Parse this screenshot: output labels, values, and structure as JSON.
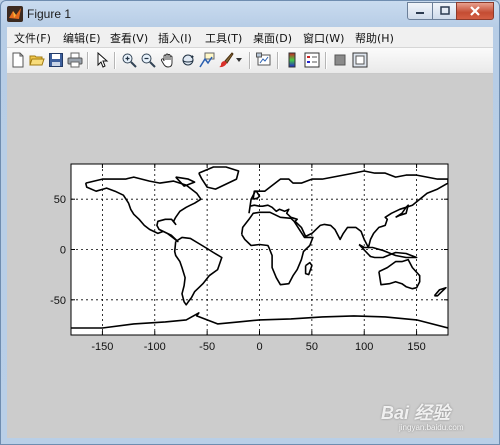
{
  "window": {
    "title": "Figure 1",
    "controls": {
      "minimize": "minimize-icon",
      "maximize": "maximize-icon",
      "close": "close-icon"
    }
  },
  "menubar": {
    "items": [
      {
        "label": "文件(F)"
      },
      {
        "label": "编辑(E)"
      },
      {
        "label": "查看(V)"
      },
      {
        "label": "插入(I)"
      },
      {
        "label": "工具(T)"
      },
      {
        "label": "桌面(D)"
      },
      {
        "label": "窗口(W)"
      },
      {
        "label": "帮助(H)"
      }
    ]
  },
  "toolbar": {
    "buttons": [
      {
        "icon": "new-figure-icon"
      },
      {
        "icon": "open-file-icon"
      },
      {
        "icon": "save-icon"
      },
      {
        "icon": "print-icon"
      },
      {
        "icon": "edit-plot-arrow-icon"
      },
      {
        "icon": "zoom-in-icon"
      },
      {
        "icon": "zoom-out-icon"
      },
      {
        "icon": "pan-hand-icon"
      },
      {
        "icon": "rotate-3d-icon"
      },
      {
        "icon": "data-cursor-icon"
      },
      {
        "icon": "brush-icon"
      },
      {
        "icon": "link-plot-icon"
      },
      {
        "icon": "colorbar-icon"
      },
      {
        "icon": "legend-icon"
      },
      {
        "icon": "hide-plot-tools-icon"
      },
      {
        "icon": "show-plot-tools-icon"
      }
    ]
  },
  "colors": {
    "figure_background": "#cccccc",
    "axes_background": "#ffffff",
    "coastline": "#000000",
    "grid": "#000000"
  },
  "chart_data": {
    "type": "line",
    "description_of_marks": "world coastline outline",
    "xlim": [
      -180,
      180
    ],
    "ylim": [
      -85,
      85
    ],
    "xticks": [
      -150,
      -100,
      -50,
      0,
      50,
      100,
      150
    ],
    "yticks": [
      -50,
      0,
      50
    ],
    "x_tick_labels": [
      "-150",
      "-100",
      "-50",
      "0",
      "50",
      "100",
      "150"
    ],
    "y_tick_labels": [
      "-50",
      "0",
      "50"
    ],
    "grid": true,
    "grid_style": "dotted",
    "title": "",
    "xlabel": "",
    "ylabel": "",
    "landmasses": [
      {
        "name": "north_america",
        "lon": [
          -166,
          -150,
          -140,
          -128,
          -120,
          -105,
          -95,
          -82,
          -70,
          -60,
          -56,
          -62,
          -66,
          -70,
          -76,
          -80,
          -82,
          -80,
          -84,
          -90,
          -97,
          -98,
          -96,
          -92,
          -88,
          -84,
          -80,
          -78,
          -83,
          -88,
          -92,
          -97,
          -101,
          -105,
          -110,
          -115,
          -118,
          -120,
          -123,
          -125,
          -130,
          -138,
          -146,
          -156,
          -165,
          -166
        ],
        "lat": [
          66,
          70,
          70,
          70,
          72,
          68,
          66,
          68,
          64,
          56,
          50,
          46,
          44,
          42,
          38,
          32,
          28,
          25,
          30,
          30,
          28,
          24,
          20,
          18,
          16,
          14,
          10,
          8,
          12,
          16,
          18,
          16,
          18,
          20,
          24,
          30,
          33,
          35,
          40,
          46,
          54,
          58,
          61,
          58,
          62,
          66
        ]
      },
      {
        "name": "south_america",
        "lon": [
          -80,
          -74,
          -66,
          -58,
          -50,
          -44,
          -36,
          -40,
          -48,
          -54,
          -58,
          -62,
          -65,
          -68,
          -70,
          -72,
          -74,
          -72,
          -71,
          -74,
          -76,
          -80,
          -81,
          -80
        ],
        "lat": [
          8,
          12,
          11,
          6,
          1,
          -3,
          -8,
          -20,
          -26,
          -34,
          -38,
          -42,
          -48,
          -52,
          -55,
          -52,
          -44,
          -36,
          -28,
          -18,
          -12,
          -6,
          -2,
          8
        ]
      },
      {
        "name": "greenland",
        "lon": [
          -58,
          -44,
          -32,
          -20,
          -22,
          -30,
          -42,
          -50,
          -55,
          -58
        ],
        "lat": [
          76,
          82,
          82,
          78,
          70,
          66,
          60,
          62,
          70,
          76
        ]
      },
      {
        "name": "eurasia",
        "lon": [
          -10,
          -9,
          -5,
          0,
          3,
          8,
          12,
          16,
          19,
          24,
          28,
          26,
          30,
          36,
          34,
          40,
          44,
          50,
          56,
          58,
          62,
          68,
          72,
          77,
          80,
          84,
          92,
          97,
          100,
          104,
          106,
          109,
          114,
          120,
          122,
          120,
          126,
          130,
          134,
          140,
          146,
          160,
          170,
          180,
          180,
          170,
          160,
          150,
          140,
          130,
          120,
          110,
          100,
          90,
          80,
          70,
          60,
          50,
          40,
          32,
          28,
          20,
          10,
          5,
          -4,
          -8,
          -10
        ],
        "lat": [
          36,
          43,
          44,
          43,
          43,
          44,
          42,
          38,
          40,
          38,
          40,
          36,
          32,
          30,
          28,
          22,
          13,
          16,
          22,
          24,
          25,
          24,
          20,
          10,
          16,
          22,
          22,
          18,
          10,
          2,
          10,
          16,
          22,
          24,
          30,
          32,
          36,
          38,
          40,
          42,
          44,
          56,
          60,
          66,
          70,
          70,
          72,
          74,
          74,
          72,
          76,
          76,
          78,
          76,
          74,
          72,
          70,
          70,
          66,
          66,
          70,
          70,
          62,
          58,
          58,
          50,
          36
        ]
      },
      {
        "name": "africa",
        "lon": [
          -17,
          -16,
          -10,
          -6,
          0,
          10,
          20,
          30,
          33,
          38,
          43,
          51,
          48,
          42,
          40,
          36,
          32,
          28,
          20,
          16,
          12,
          12,
          9,
          8,
          0,
          -8,
          -14,
          -17
        ],
        "lat": [
          15,
          22,
          30,
          36,
          37,
          37,
          32,
          31,
          28,
          20,
          12,
          12,
          4,
          -2,
          -10,
          -20,
          -26,
          -34,
          -35,
          -28,
          -18,
          -6,
          2,
          4,
          5,
          4,
          10,
          15
        ]
      },
      {
        "name": "australia",
        "lon": [
          114,
          122,
          130,
          136,
          142,
          146,
          153,
          153,
          150,
          146,
          140,
          136,
          130,
          124,
          116,
          114
        ],
        "lat": [
          -22,
          -18,
          -12,
          -12,
          -10,
          -18,
          -26,
          -32,
          -38,
          -39,
          -37,
          -34,
          -32,
          -34,
          -35,
          -22
        ]
      },
      {
        "name": "antarctica",
        "lon": [
          -180,
          -150,
          -120,
          -90,
          -70,
          -58,
          -60,
          -40,
          -20,
          0,
          30,
          60,
          90,
          120,
          150,
          180
        ],
        "lat": [
          -78,
          -78,
          -74,
          -72,
          -70,
          -63,
          -66,
          -74,
          -72,
          -70,
          -69,
          -67,
          -66,
          -67,
          -70,
          -78
        ]
      },
      {
        "name": "madagascar",
        "lon": [
          44,
          48,
          50,
          47,
          44,
          44
        ],
        "lat": [
          -16,
          -13,
          -16,
          -25,
          -24,
          -16
        ]
      },
      {
        "name": "british_isles",
        "lon": [
          -6,
          -2,
          0,
          -3,
          -5,
          -6
        ],
        "lat": [
          50,
          51,
          53,
          58,
          58,
          50
        ]
      },
      {
        "name": "japan",
        "lon": [
          130,
          134,
          140,
          142,
          140,
          136,
          130
        ],
        "lat": [
          32,
          34,
          36,
          44,
          42,
          36,
          32
        ]
      },
      {
        "name": "new_zealand",
        "lon": [
          167,
          172,
          178,
          174,
          170,
          167
        ],
        "lat": [
          -46,
          -40,
          -38,
          -42,
          -46,
          -46
        ]
      },
      {
        "name": "indonesia",
        "lon": [
          95,
          105,
          106,
          110,
          118,
          125,
          130,
          140,
          150,
          140,
          130,
          118,
          108,
          100,
          95
        ],
        "lat": [
          5,
          -6,
          -7,
          -8,
          -8,
          -5,
          -3,
          -4,
          -8,
          -8,
          -6,
          -1,
          2,
          2,
          5
        ]
      },
      {
        "name": "baffin_island",
        "lon": [
          -80,
          -68,
          -62,
          -72,
          -80
        ],
        "lat": [
          72,
          70,
          67,
          63,
          72
        ]
      }
    ]
  },
  "watermark": {
    "text": "Bai 经验",
    "subtext": "jingyan.baidu.com"
  }
}
